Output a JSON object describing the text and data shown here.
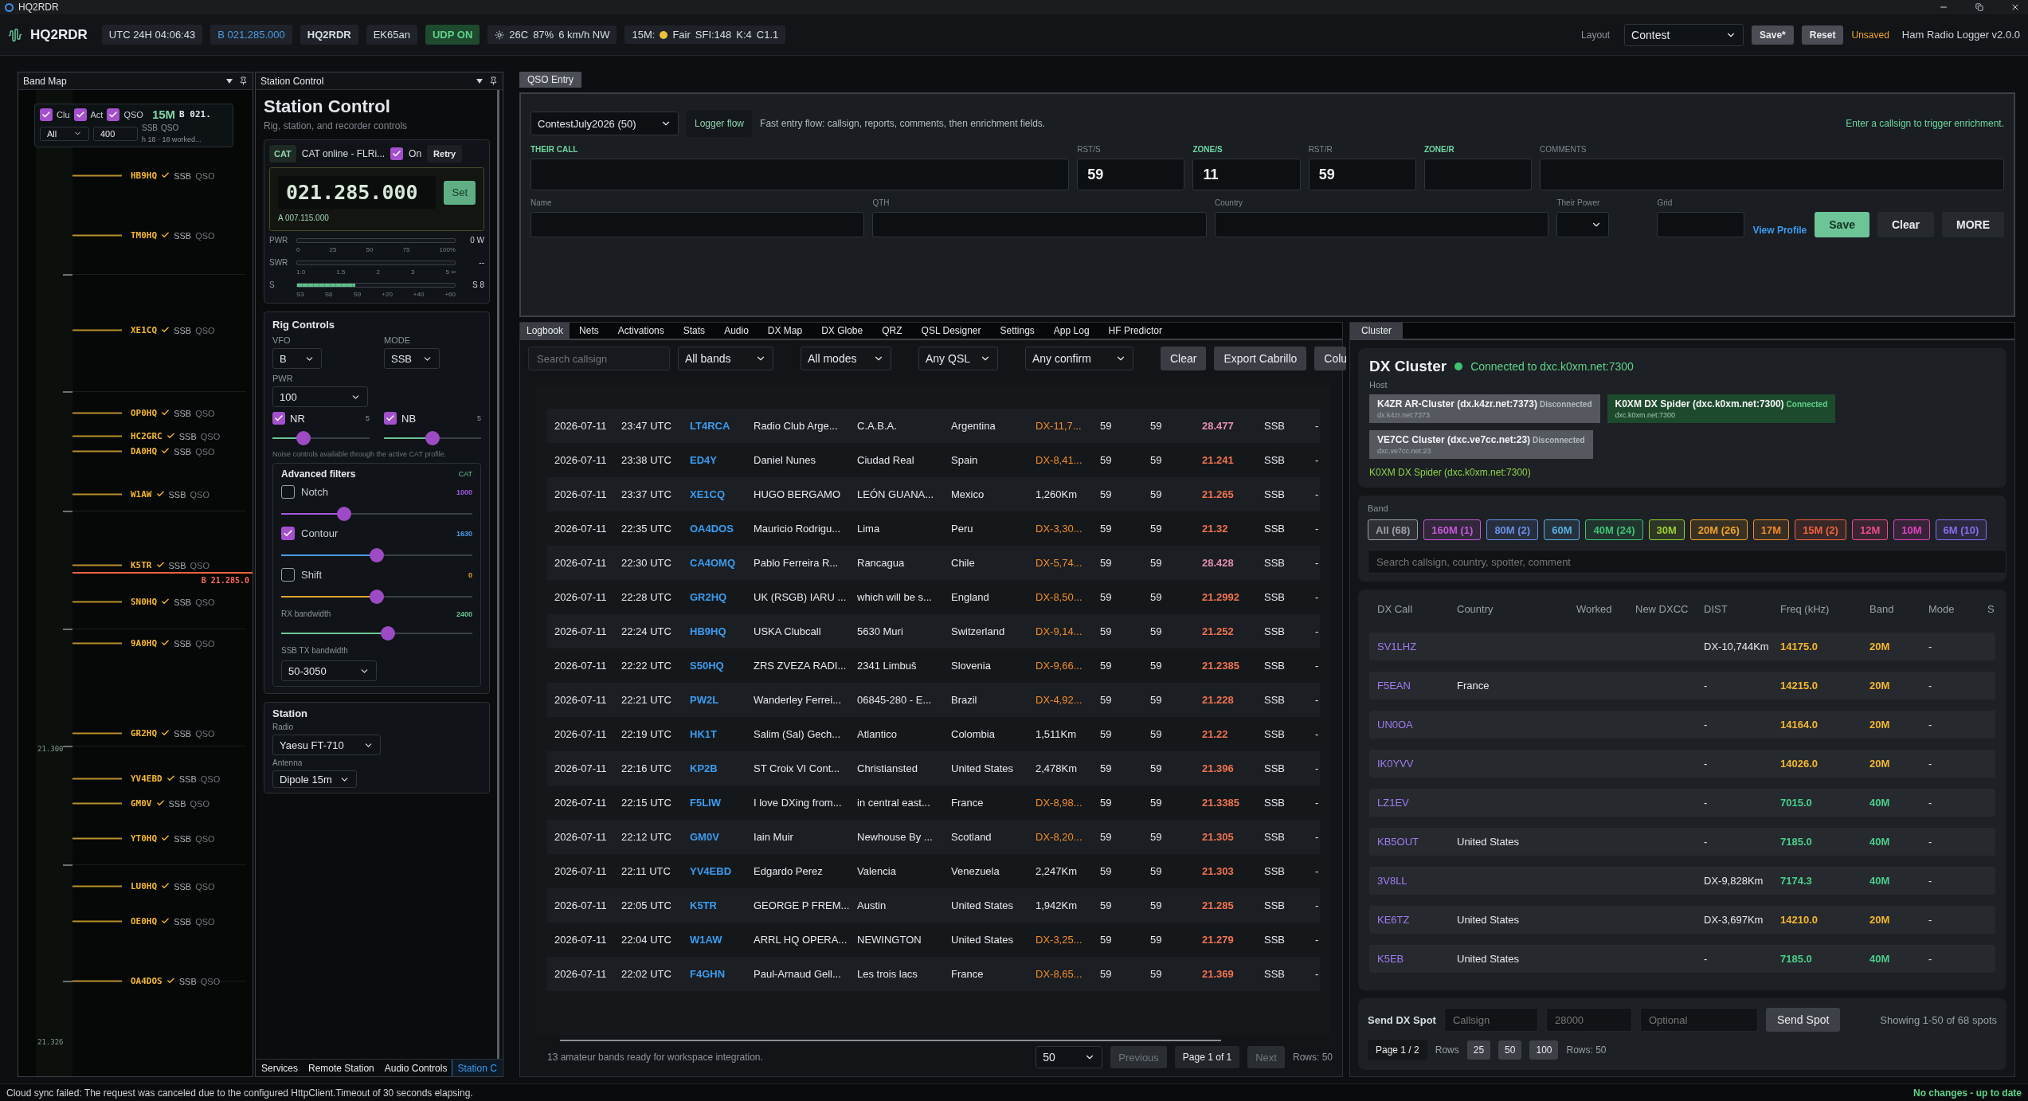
{
  "window": {
    "title": "HQ2RDR"
  },
  "top_bar": {
    "app_name": "HQ2RDR",
    "clock": "UTC 24H 04:06:43",
    "vfo_frequency": "B 021.285.000",
    "station_call": "HQ2RDR",
    "grid": "EK65an",
    "udp": {
      "label": "UDP ON",
      "on": true
    },
    "weather": [
      "26C",
      "87%",
      "6 km/h NW"
    ],
    "propagation": {
      "band": "15M:",
      "condition": "Fair",
      "color": "#e8c23a",
      "indices": [
        "SFI:148",
        "K:4",
        "C1.1"
      ]
    },
    "layout_label": "Layout",
    "layout": "Contest",
    "buttons": [
      "Save*",
      "Reset"
    ],
    "unsaved": "Unsaved",
    "version": "Ham Radio Logger v2.0.0"
  },
  "band_map": {
    "title": "Band Map",
    "filters": [
      {
        "label": "Clu",
        "checked": true
      },
      {
        "label": "Act",
        "checked": true
      },
      {
        "label": "QSO",
        "checked": true
      }
    ],
    "band": "15M",
    "vfo": "B 021.",
    "mode_filter": "All",
    "span": "400",
    "hidden_spot_tags": [
      "SSB",
      "QSO"
    ],
    "summary": "h  18 · 18 worked...",
    "spots": [
      {
        "call": "HB9HQ",
        "worked": true,
        "mode": "SSB",
        "tag": "QSO"
      },
      {
        "call": "TM0HQ",
        "worked": true,
        "mode": "SSB",
        "tag": "QSO"
      },
      {
        "call": "XE1CQ",
        "worked": true,
        "mode": "SSB",
        "tag": "QSO"
      },
      {
        "call": "OP0HQ",
        "worked": true,
        "mode": "SSB",
        "tag": "QSO"
      },
      {
        "call": "HC2GRC",
        "worked": true,
        "mode": "SSB",
        "tag": "QSO"
      },
      {
        "call": "DA0HQ",
        "worked": true,
        "mode": "SSB",
        "tag": "QSO"
      },
      {
        "call": "W1AW",
        "worked": true,
        "mode": "SSB",
        "tag": "QSO"
      },
      {
        "call": "K5TR",
        "worked": true,
        "mode": "SSB",
        "tag": "QSO"
      },
      {
        "call": "SN0HQ",
        "worked": true,
        "mode": "SSB",
        "tag": "QSO"
      },
      {
        "call": "9A0HQ",
        "worked": true,
        "mode": "SSB",
        "tag": "QSO"
      },
      {
        "call": "GR2HQ",
        "worked": true,
        "mode": "SSB",
        "tag": "QSO"
      },
      {
        "call": "YV4EBD",
        "worked": true,
        "mode": "SSB",
        "tag": "QSO"
      },
      {
        "call": "GM0V",
        "worked": true,
        "mode": "SSB",
        "tag": "QSO"
      },
      {
        "call": "YT0HQ",
        "worked": true,
        "mode": "SSB",
        "tag": "QSO"
      },
      {
        "call": "LU0HQ",
        "worked": true,
        "mode": "SSB",
        "tag": "QSO"
      },
      {
        "call": "OE0HQ",
        "worked": true,
        "mode": "SSB",
        "tag": "QSO"
      },
      {
        "call": "OA4DOS",
        "worked": true,
        "mode": "SSB",
        "tag": "QSO"
      }
    ],
    "vfo_marker": "B 21.285.0",
    "scale_labels": [
      "21.300",
      "21.326"
    ]
  },
  "station_control": {
    "title": "Station Control",
    "heading": "Station Control",
    "subtitle": "Rig, station, and recorder controls",
    "cat": {
      "badge": "CAT",
      "status": "CAT online - FLRi...",
      "on_label": "On",
      "on": true,
      "retry": "Retry"
    },
    "frequency": "021.285.000",
    "set": "Set",
    "secondary_vfo": "A 007.115.000",
    "meters": [
      {
        "label": "PWR",
        "ticks": [
          "0",
          "25",
          "50",
          "75",
          "100%"
        ],
        "reading": "0 W"
      },
      {
        "label": "SWR",
        "ticks": [
          "1.0",
          "1.5",
          "2",
          "3",
          "5 ∞"
        ],
        "reading": "--"
      },
      {
        "label": "S",
        "level": 0.37,
        "ticks": [
          "S3",
          "S6",
          "S9",
          "+20",
          "+40",
          "+60"
        ],
        "reading": "S 8"
      }
    ],
    "rig": {
      "title": "Rig Controls",
      "vfo_label": "VFO",
      "vfo": "B",
      "mode_label": "MODE",
      "mode": "SSB",
      "pwr_label": "PWR",
      "pwr": "100",
      "toggles": [
        {
          "label": "NR",
          "checked": true,
          "value": "5",
          "level": 0.32
        },
        {
          "label": "NB",
          "checked": true,
          "value": "5",
          "level": 0.5
        }
      ],
      "note": "Noise controls available through the active CAT profile.",
      "advanced": {
        "title": "Advanced filters",
        "badge": "CAT",
        "filters": [
          {
            "kind": "check",
            "label": "Notch",
            "checked": false,
            "value": "1000",
            "level": 0.33,
            "color": "#a15be0"
          },
          {
            "kind": "check",
            "label": "Contour",
            "checked": true,
            "value": "1630",
            "level": 0.5,
            "color": "#4a9be6"
          },
          {
            "kind": "check",
            "label": "Shift",
            "checked": false,
            "value": "0",
            "level": 0.5,
            "color": "#e0a435"
          },
          {
            "kind": "plain",
            "label": "RX bandwidth",
            "value": "2400",
            "level": 0.56,
            "color": "#6cc497"
          }
        ],
        "tx_label": "SSB TX bandwidth",
        "tx_value": "50-3050"
      }
    },
    "station": {
      "title": "Station",
      "radio_label": "Radio",
      "radio": "Yaesu FT-710",
      "antenna_label": "Antenna",
      "antenna": "Dipole 15m"
    },
    "tabs": [
      {
        "label": "Services",
        "selected": false
      },
      {
        "label": "Remote Station",
        "selected": false
      },
      {
        "label": "Audio Controls",
        "selected": false
      },
      {
        "label": "Station C",
        "selected": true
      }
    ]
  },
  "qso_entry": {
    "tab": "QSO Entry",
    "contest": "ContestJuly2026 (50)",
    "logger_flow": "Logger flow",
    "hint": "Fast entry flow: callsign, reports, comments, then enrichment fields.",
    "enrich_hint": "Enter a callsign to trigger enrichment.",
    "fields": [
      {
        "label": "THEIR CALL",
        "required": true
      },
      {
        "label": "RST/S",
        "required": false,
        "value": "59"
      },
      {
        "label": "ZONE/S",
        "required": true,
        "value": "11"
      },
      {
        "label": "RST/R",
        "required": false,
        "value": "59"
      },
      {
        "label": "ZONE/R",
        "required": true
      },
      {
        "label": "COMMENTS",
        "required": false
      }
    ],
    "details": [
      {
        "kind": "text",
        "label": "Name"
      },
      {
        "kind": "text",
        "label": "QTH"
      },
      {
        "kind": "text",
        "label": "Country"
      },
      {
        "kind": "select",
        "label": "Their Power"
      },
      {
        "kind": "text",
        "label": "Grid"
      }
    ],
    "view_profile": "View Profile",
    "buttons": [
      {
        "label": "Save",
        "primary": true
      },
      {
        "label": "Clear",
        "primary": false
      },
      {
        "label": "MORE",
        "primary": false
      }
    ]
  },
  "logbook": {
    "tabs": [
      {
        "label": "Logbook",
        "selected": true
      },
      {
        "label": "Nets",
        "selected": false
      },
      {
        "label": "Activations",
        "selected": false
      },
      {
        "label": "Stats",
        "selected": false
      },
      {
        "label": "Audio",
        "selected": false
      },
      {
        "label": "DX Map",
        "selected": false
      },
      {
        "label": "DX Globe",
        "selected": false
      },
      {
        "label": "QRZ",
        "selected": false
      },
      {
        "label": "QSL Designer",
        "selected": false
      },
      {
        "label": "Settings",
        "selected": false
      },
      {
        "label": "App Log",
        "selected": false
      },
      {
        "label": "HF Predictor",
        "selected": false
      }
    ],
    "search": {
      "placeholder": "Search callsign"
    },
    "filters": [
      "All bands",
      "All modes",
      "Any QSL",
      "Any confirm"
    ],
    "buttons": [
      "Clear",
      "Export Cabrillo",
      "Colu"
    ],
    "rows": [
      {
        "date": "2026-07-11",
        "time": "23:47 UTC",
        "call": "LT4RCA",
        "name": "Radio Club Arge...",
        "qth": "C.A.B.A.",
        "country": "Argentina",
        "dist": "DX-11,7...",
        "dx": true,
        "rst_s": "59",
        "rst_r": "59",
        "freq": "28.477",
        "color": "#e58fb3",
        "mode": "SSB",
        "extra": "-"
      },
      {
        "date": "2026-07-11",
        "time": "23:38 UTC",
        "call": "ED4Y",
        "name": "Daniel Nunes",
        "qth": "Ciudad Real",
        "country": "Spain",
        "dist": "DX-8,41...",
        "dx": true,
        "rst_s": "59",
        "rst_r": "59",
        "freq": "21.241",
        "color": "#f07350",
        "mode": "SSB",
        "extra": "-"
      },
      {
        "date": "2026-07-11",
        "time": "23:37 UTC",
        "call": "XE1CQ",
        "name": "HUGO BERGAMO",
        "qth": "LEÓN GUANA...",
        "country": "Mexico",
        "dist": "1,260Km",
        "dx": false,
        "rst_s": "59",
        "rst_r": "59",
        "freq": "21.265",
        "color": "#f07350",
        "mode": "SSB",
        "extra": "-"
      },
      {
        "date": "2026-07-11",
        "time": "22:35 UTC",
        "call": "OA4DOS",
        "name": "Mauricio Rodrigu...",
        "qth": "Lima",
        "country": "Peru",
        "dist": "DX-3,30...",
        "dx": true,
        "rst_s": "59",
        "rst_r": "59",
        "freq": "21.32",
        "color": "#f07350",
        "mode": "SSB",
        "extra": "-"
      },
      {
        "date": "2026-07-11",
        "time": "22:30 UTC",
        "call": "CA4OMQ",
        "name": "Pablo Ferreira R...",
        "qth": "Rancagua",
        "country": "Chile",
        "dist": "DX-5,74...",
        "dx": true,
        "rst_s": "59",
        "rst_r": "59",
        "freq": "28.428",
        "color": "#e58fb3",
        "mode": "SSB",
        "extra": "-"
      },
      {
        "date": "2026-07-11",
        "time": "22:28 UTC",
        "call": "GR2HQ",
        "name": "UK (RSGB) IARU ...",
        "qth": "which will be s...",
        "country": "England",
        "dist": "DX-8,50...",
        "dx": true,
        "rst_s": "59",
        "rst_r": "59",
        "freq": "21.2992",
        "color": "#f07350",
        "mode": "SSB",
        "extra": "-"
      },
      {
        "date": "2026-07-11",
        "time": "22:24 UTC",
        "call": "HB9HQ",
        "name": "USKA Clubcall",
        "qth": "5630 Muri",
        "country": "Switzerland",
        "dist": "DX-9,14...",
        "dx": true,
        "rst_s": "59",
        "rst_r": "59",
        "freq": "21.252",
        "color": "#f07350",
        "mode": "SSB",
        "extra": "-"
      },
      {
        "date": "2026-07-11",
        "time": "22:22 UTC",
        "call": "S50HQ",
        "name": "ZRS ZVEZA RADI...",
        "qth": "2341 Limbuš",
        "country": "Slovenia",
        "dist": "DX-9,66...",
        "dx": true,
        "rst_s": "59",
        "rst_r": "59",
        "freq": "21.2385",
        "color": "#f07350",
        "mode": "SSB",
        "extra": "-"
      },
      {
        "date": "2026-07-11",
        "time": "22:21 UTC",
        "call": "PW2L",
        "name": "Wanderley Ferrei...",
        "qth": "06845-280 - E...",
        "country": "Brazil",
        "dist": "DX-4,92...",
        "dx": true,
        "rst_s": "59",
        "rst_r": "59",
        "freq": "21.228",
        "color": "#f07350",
        "mode": "SSB",
        "extra": "-"
      },
      {
        "date": "2026-07-11",
        "time": "22:19 UTC",
        "call": "HK1T",
        "name": "Salim (Sal) Gech...",
        "qth": "Atlantico",
        "country": "Colombia",
        "dist": "1,511Km",
        "dx": false,
        "rst_s": "59",
        "rst_r": "59",
        "freq": "21.22",
        "color": "#f07350",
        "mode": "SSB",
        "extra": "-"
      },
      {
        "date": "2026-07-11",
        "time": "22:16 UTC",
        "call": "KP2B",
        "name": "ST Croix VI Cont...",
        "qth": "Christiansted",
        "country": "United States",
        "dist": "2,478Km",
        "dx": false,
        "rst_s": "59",
        "rst_r": "59",
        "freq": "21.396",
        "color": "#f07350",
        "mode": "SSB",
        "extra": "-"
      },
      {
        "date": "2026-07-11",
        "time": "22:15 UTC",
        "call": "F5LIW",
        "name": "I love DXing from...",
        "qth": "in central east...",
        "country": "France",
        "dist": "DX-8,98...",
        "dx": true,
        "rst_s": "59",
        "rst_r": "59",
        "freq": "21.3385",
        "color": "#f07350",
        "mode": "SSB",
        "extra": "-"
      },
      {
        "date": "2026-07-11",
        "time": "22:12 UTC",
        "call": "GM0V",
        "name": "Iain Muir",
        "qth": "Newhouse By ...",
        "country": "Scotland",
        "dist": "DX-8,20...",
        "dx": true,
        "rst_s": "59",
        "rst_r": "59",
        "freq": "21.305",
        "color": "#f07350",
        "mode": "SSB",
        "extra": "-"
      },
      {
        "date": "2026-07-11",
        "time": "22:11 UTC",
        "call": "YV4EBD",
        "name": "Edgardo Perez",
        "qth": "Valencia",
        "country": "Venezuela",
        "dist": "2,247Km",
        "dx": false,
        "rst_s": "59",
        "rst_r": "59",
        "freq": "21.303",
        "color": "#f07350",
        "mode": "SSB",
        "extra": "-"
      },
      {
        "date": "2026-07-11",
        "time": "22:05 UTC",
        "call": "K5TR",
        "name": "GEORGE P FREM...",
        "qth": "Austin",
        "country": "United States",
        "dist": "1,942Km",
        "dx": false,
        "rst_s": "59",
        "rst_r": "59",
        "freq": "21.285",
        "color": "#f07350",
        "mode": "SSB",
        "extra": "-"
      },
      {
        "date": "2026-07-11",
        "time": "22:04 UTC",
        "call": "W1AW",
        "name": "ARRL HQ OPERA...",
        "qth": "NEWINGTON",
        "country": "United States",
        "dist": "DX-3,25...",
        "dx": true,
        "rst_s": "59",
        "rst_r": "59",
        "freq": "21.279",
        "color": "#f07350",
        "mode": "SSB",
        "extra": "-"
      },
      {
        "date": "2026-07-11",
        "time": "22:02 UTC",
        "call": "F4GHN",
        "name": "Paul-Arnaud Gell...",
        "qth": "Les trois lacs",
        "country": "France",
        "dist": "DX-8,65...",
        "dx": true,
        "rst_s": "59",
        "rst_r": "59",
        "freq": "21.369",
        "color": "#f07350",
        "mode": "SSB",
        "extra": "-"
      }
    ],
    "footer": {
      "note": "13 amateur bands ready for workspace integration.",
      "page_size": "50",
      "previous": {
        "label": "Previous",
        "disabled": true
      },
      "page": "Page 1 of 1",
      "next": {
        "label": "Next",
        "disabled": true
      },
      "rows": "Rows: 50"
    }
  },
  "cluster": {
    "tab": "Cluster",
    "title": "DX Cluster",
    "status": "Connected to dxc.k0xm.net:7300",
    "connected": true,
    "host_label": "Host",
    "hosts": [
      {
        "name": "K4ZR AR-Cluster (dx.k4zr.net:7373)",
        "status": "Disconnected",
        "address": "dx.k4zr.net:7373",
        "connected": false
      },
      {
        "name": "K0XM DX Spider (dxc.k0xm.net:7300)",
        "status": "Connected",
        "address": "dxc.k0xm.net:7300",
        "connected": true
      },
      {
        "name": "VE7CC Cluster (dxc.ve7cc.net:23)",
        "status": "Disconnected",
        "address": "dxc.ve7cc.net:23",
        "connected": false
      }
    ],
    "active_host": "K0XM DX Spider (dxc.k0xm.net:7300)",
    "band_label": "Band",
    "bands": [
      {
        "label": "All (68)",
        "color": "#9aa0a6"
      },
      {
        "label": "160M (1)",
        "color": "#c25ad6"
      },
      {
        "label": "80M (2)",
        "color": "#6b8fe6"
      },
      {
        "label": "60M",
        "color": "#5aaede"
      },
      {
        "label": "40M (24)",
        "color": "#3ec374"
      },
      {
        "label": "30M",
        "color": "#9ccf32"
      },
      {
        "label": "20M (26)",
        "color": "#f0a326"
      },
      {
        "label": "17M",
        "color": "#f08c28"
      },
      {
        "label": "15M (2)",
        "color": "#f0623f"
      },
      {
        "label": "12M",
        "color": "#f04a8c"
      },
      {
        "label": "10M",
        "color": "#e043c2"
      },
      {
        "label": "6M (10)",
        "color": "#8a6cf0"
      }
    ],
    "search": {
      "placeholder": "Search callsign, country, spotter, comment"
    },
    "columns": [
      "DX Call",
      "Country",
      "Worked",
      "New DXCC",
      "DIST",
      "Freq (kHz)",
      "Band",
      "Mode",
      "S"
    ],
    "rows": [
      {
        "call": "SV1LHZ",
        "dist": "DX-10,744Km",
        "freq": "14175.0",
        "band": "20M",
        "color": "#f5b82e",
        "mode": "-"
      },
      {
        "call": "F5EAN",
        "country": "France",
        "dist": "-",
        "freq": "14215.0",
        "band": "20M",
        "color": "#f5b82e",
        "mode": "-"
      },
      {
        "call": "UN0OA",
        "dist": "-",
        "freq": "14164.0",
        "band": "20M",
        "color": "#f5b82e",
        "mode": "-"
      },
      {
        "call": "IK0YVV",
        "dist": "-",
        "freq": "14026.0",
        "band": "20M",
        "color": "#f5b82e",
        "mode": "-"
      },
      {
        "call": "LZ1EV",
        "dist": "-",
        "freq": "7015.0",
        "band": "40M",
        "color": "#48d08a",
        "mode": "-"
      },
      {
        "call": "KB5OUT",
        "country": "United States",
        "dist": "-",
        "freq": "7185.0",
        "band": "40M",
        "color": "#48d08a",
        "mode": "-"
      },
      {
        "call": "3V8LL",
        "dist": "DX-9,828Km",
        "freq": "7174.3",
        "band": "40M",
        "color": "#48d08a",
        "mode": "-"
      },
      {
        "call": "KE6TZ",
        "country": "United States",
        "dist": "DX-3,697Km",
        "freq": "14210.0",
        "band": "20M",
        "color": "#f5b82e",
        "mode": "-"
      },
      {
        "call": "K5EB",
        "country": "United States",
        "dist": "-",
        "freq": "7185.0",
        "band": "40M",
        "color": "#48d08a",
        "mode": "-"
      }
    ],
    "send": {
      "label": "Send DX Spot",
      "placeholders": [
        "Callsign",
        "28000",
        "Optional"
      ],
      "button": "Send Spot",
      "showing": "Showing 1-50 of 68 spots",
      "page": "Page 1 / 2",
      "rows_label": "Rows",
      "row_options": [
        {
          "label": "25",
          "selected": false
        },
        {
          "label": "50",
          "selected": false
        },
        {
          "label": "100",
          "selected": false
        }
      ],
      "rows": "Rows: 50"
    }
  },
  "status_bar": {
    "message": "Cloud sync failed: The request was canceled due to the configured HttpClient.Timeout of 30 seconds elapsing.",
    "sync": "No changes - up to date"
  }
}
